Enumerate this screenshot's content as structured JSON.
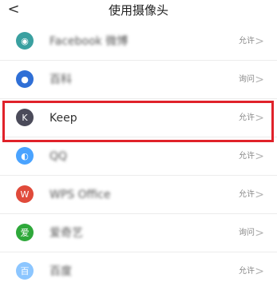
{
  "header": {
    "back_glyph": "<",
    "title": "使用摄像头"
  },
  "apps": [
    {
      "name": "Facebook 微博",
      "permission": "允许",
      "icon": "camera-robot-icon",
      "color": "#3aa0a0"
    },
    {
      "name": "百科",
      "permission": "询问",
      "icon": "person-icon",
      "color": "#2f6fd6"
    },
    {
      "name": "Keep",
      "permission": "允许",
      "icon": "keep-k-icon",
      "color": "#4b4b5a"
    },
    {
      "name": "QQ",
      "permission": "允许",
      "icon": "qq-penguin-icon",
      "color": "#4aa3ff"
    },
    {
      "name": "WPS Office",
      "permission": "允许",
      "icon": "wps-icon",
      "color": "#e04a3a"
    },
    {
      "name": "爱奇艺",
      "permission": "询问",
      "icon": "iqiyi-icon",
      "color": "#2ea83a"
    },
    {
      "name": "百度",
      "permission": "允许",
      "icon": "baidu-icon",
      "color": "#8cc6ff"
    }
  ],
  "chevron": ">"
}
